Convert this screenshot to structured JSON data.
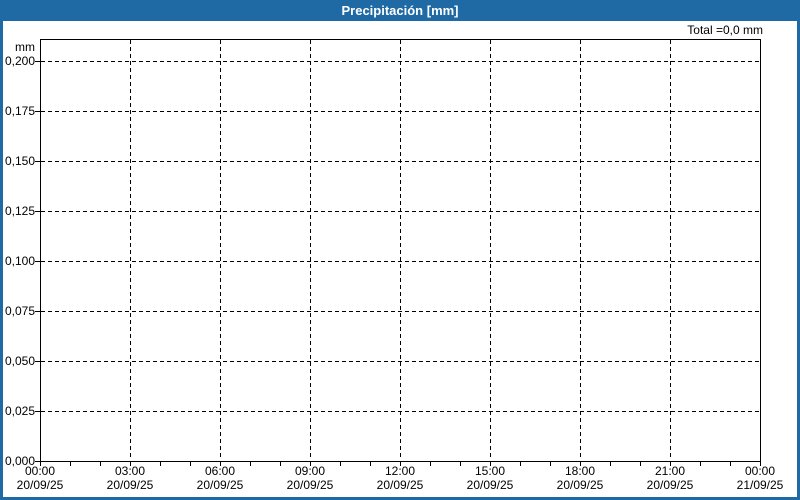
{
  "header": {
    "title": "Precipitación [mm]"
  },
  "summary": {
    "total_label": "Total =0,0 mm"
  },
  "colors": {
    "accent_blue": "#1F6AA5",
    "grid_line": "#000000",
    "background": "#FFFFFF",
    "title_text": "#FFFFFF",
    "label_text": "#000000"
  },
  "chart_data": {
    "type": "bar",
    "title": "Precipitación [mm]",
    "y_unit": "mm",
    "ylabel": "mm",
    "ylim": [
      0,
      0.211
    ],
    "grid": "dashed",
    "legend_position": "none",
    "total_annotation": "Total =0,0 mm",
    "y_ticks": [
      {
        "value": 0.0,
        "label": "0,000"
      },
      {
        "value": 0.025,
        "label": "0,025"
      },
      {
        "value": 0.05,
        "label": "0,050"
      },
      {
        "value": 0.075,
        "label": "0,075"
      },
      {
        "value": 0.1,
        "label": "0,100"
      },
      {
        "value": 0.125,
        "label": "0,125"
      },
      {
        "value": 0.15,
        "label": "0,150"
      },
      {
        "value": 0.175,
        "label": "0,175"
      },
      {
        "value": 0.2,
        "label": "0,200"
      }
    ],
    "x_axis": {
      "start_hour": 0,
      "end_hour": 24,
      "minor_tick_interval_hours": 1,
      "major_ticks": [
        {
          "hour": 0,
          "time": "00:00",
          "date": "20/09/25"
        },
        {
          "hour": 3,
          "time": "03:00",
          "date": "20/09/25"
        },
        {
          "hour": 6,
          "time": "06:00",
          "date": "20/09/25"
        },
        {
          "hour": 9,
          "time": "09:00",
          "date": "20/09/25"
        },
        {
          "hour": 12,
          "time": "12:00",
          "date": "20/09/25"
        },
        {
          "hour": 15,
          "time": "15:00",
          "date": "20/09/25"
        },
        {
          "hour": 18,
          "time": "18:00",
          "date": "20/09/25"
        },
        {
          "hour": 21,
          "time": "21:00",
          "date": "20/09/25"
        },
        {
          "hour": 24,
          "time": "00:00",
          "date": "21/09/25"
        }
      ]
    },
    "series": []
  }
}
